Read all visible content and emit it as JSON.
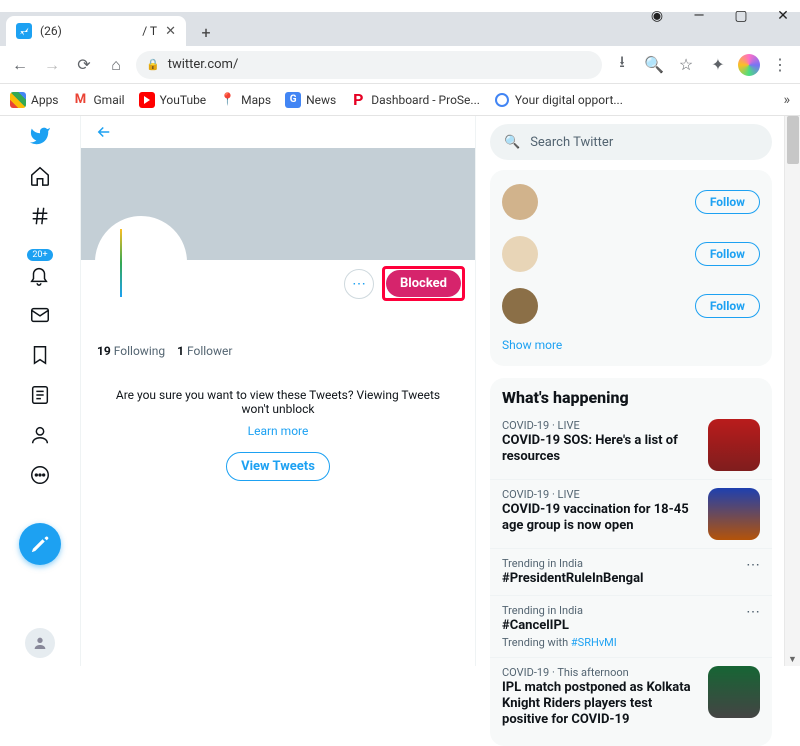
{
  "window": {
    "tab_title": "(26)",
    "tab_title2": "/ T",
    "url": "twitter.com/"
  },
  "bookmarks": {
    "apps": "Apps",
    "gmail": "Gmail",
    "youtube": "YouTube",
    "maps": "Maps",
    "news": "News",
    "dashboard": "Dashboard - ProSe...",
    "digital": "Your digital opport..."
  },
  "nav": {
    "notif_badge": "20+"
  },
  "profile": {
    "blocked_label": "Blocked",
    "following_count": "19",
    "following_label": "Following",
    "followers_count": "1",
    "followers_label": "Follower",
    "confirm_text": "Are you sure you want to view these Tweets? Viewing Tweets won't unblock",
    "learn_more": "Learn more",
    "view_tweets": "View Tweets"
  },
  "search": {
    "placeholder": "Search Twitter"
  },
  "suggestions": {
    "follow": "Follow",
    "show_more": "Show more"
  },
  "happening": {
    "heading": "What's happening",
    "items": [
      {
        "cat": "COVID-19 · LIVE",
        "title": "COVID-19 SOS: Here's a list of resources",
        "sub": "",
        "img": true
      },
      {
        "cat": "COVID-19 · LIVE",
        "title": "COVID-19 vaccination for 18-45 age group is now open",
        "sub": "",
        "img": true
      },
      {
        "cat": "Trending in India",
        "title": "#PresidentRuleInBengal",
        "sub": "",
        "img": false
      },
      {
        "cat": "Trending in India",
        "title": "#CancelIPL",
        "sub": "Trending with ",
        "subhl": "#SRHvMI",
        "img": false
      },
      {
        "cat": "COVID-19 · This afternoon",
        "title": "IPL match postponed as Kolkata Knight Riders players test positive for COVID-19",
        "sub": "",
        "img": true
      }
    ]
  }
}
